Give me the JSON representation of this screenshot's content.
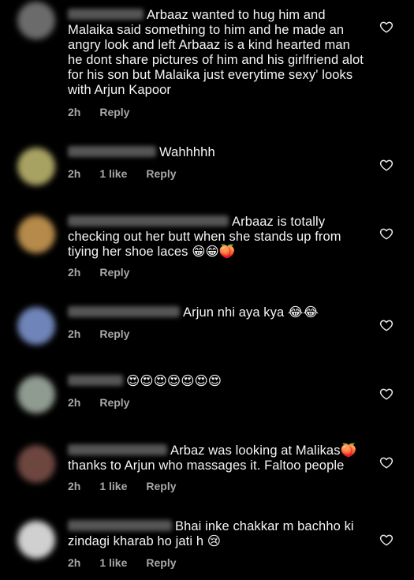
{
  "comments": [
    {
      "text": "Arbaaz wanted to hug him and Malaika said something to him and he made an angry look and left Arbaaz is a kind hearted man he dont share pictures of him and his girlfriend alot for his son but Malaika just everytime sexy' looks with Arjun Kapoor",
      "time": "2h",
      "likes": "",
      "reply": "Reply",
      "avatar_color": "#6b6b6b"
    },
    {
      "text": "Wahhhhh",
      "time": "2h",
      "likes": "1 like",
      "reply": "Reply",
      "avatar_color": "#a8a262"
    },
    {
      "text": "Arbaaz is totally checking out her butt when she stands up from tiying her shoe laces 😁😁🍑",
      "time": "2h",
      "likes": "",
      "reply": "Reply",
      "avatar_color": "#b58a4a"
    },
    {
      "text": "Arjun nhi aya kya 😂😂",
      "time": "2h",
      "likes": "",
      "reply": "Reply",
      "avatar_color": "#6f84b8"
    },
    {
      "text": "😍😍😍😍😍😍😍",
      "time": "2h",
      "likes": "",
      "reply": "Reply",
      "avatar_color": "#8f9a90"
    },
    {
      "text": "Arbaz was looking at Malikas🍑 thanks to Arjun who massages it. Faltoo people",
      "time": "2h",
      "likes": "1 like",
      "reply": "Reply",
      "avatar_color": "#6e4640"
    },
    {
      "text": "Bhai inke chakkar m bachho ki zindagi kharab ho jati h 😢",
      "time": "2h",
      "likes": "1 like",
      "reply": "Reply",
      "avatar_color": "#d0d0d0"
    }
  ],
  "icons": {
    "like": "heart-outline-icon"
  }
}
